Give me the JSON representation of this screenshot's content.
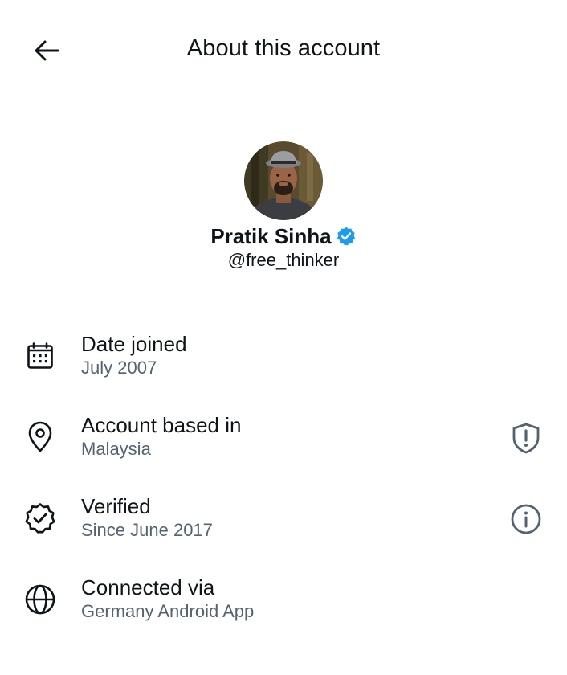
{
  "header": {
    "title": "About this account",
    "back_icon": "arrow-left-icon"
  },
  "profile": {
    "name": "Pratik Sinha",
    "handle": "@free_thinker",
    "verified_icon": "verified-badge-icon",
    "badge_color": "#1d9bf0"
  },
  "info": {
    "date_joined": {
      "label": "Date joined",
      "value": "July 2007",
      "icon": "calendar-icon"
    },
    "account_based": {
      "label": "Account based in",
      "value": "Malaysia",
      "icon": "location-pin-icon",
      "trailing_icon": "shield-alert-icon"
    },
    "verified": {
      "label": "Verified",
      "value": "Since June 2017",
      "icon": "verified-check-icon",
      "trailing_icon": "info-icon"
    },
    "connected_via": {
      "label": "Connected via",
      "value": "Germany Android App",
      "icon": "globe-icon"
    }
  },
  "colors": {
    "text_primary": "#0f1419",
    "text_secondary": "#536471",
    "accent": "#1d9bf0"
  }
}
